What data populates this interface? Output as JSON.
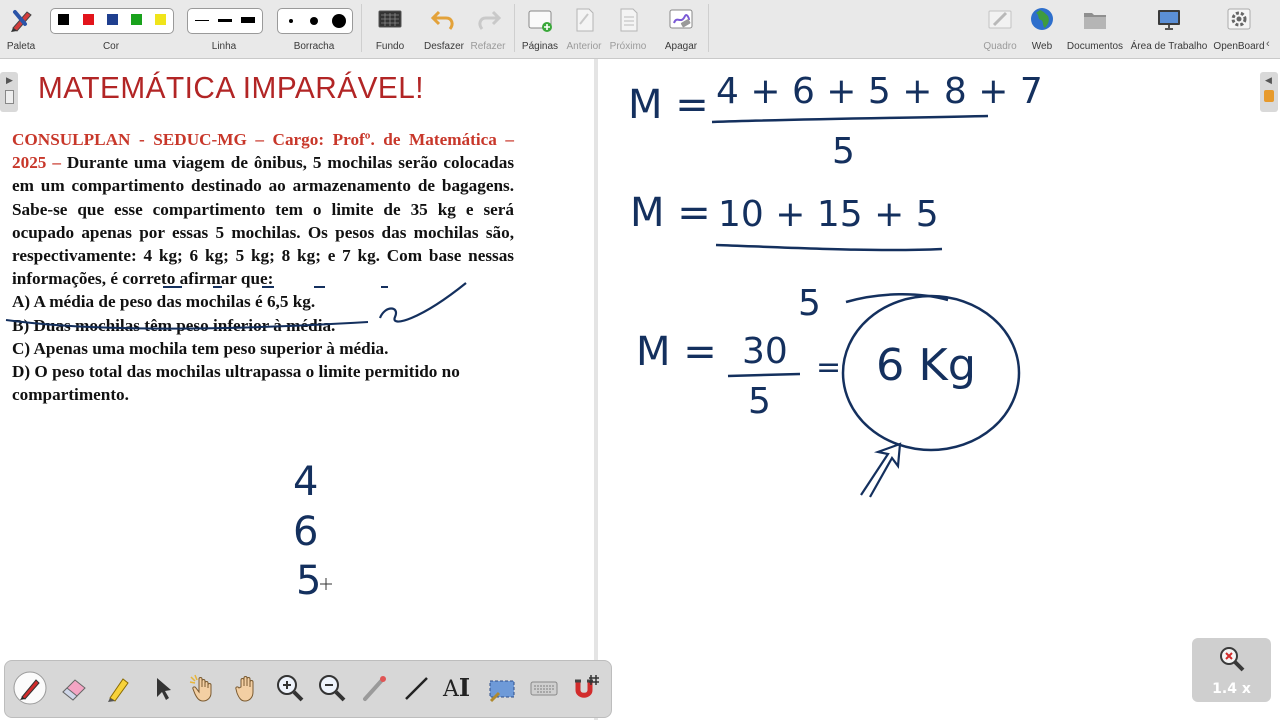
{
  "toolbar": {
    "palette_label": "Paleta",
    "color_label": "Cor",
    "line_label": "Linha",
    "eraser_label": "Borracha",
    "background_label": "Fundo",
    "undo_label": "Desfazer",
    "redo_label": "Refazer",
    "pages_label": "Páginas",
    "previous_label": "Anterior",
    "next_label": "Próximo",
    "erase_label": "Apagar",
    "board_label": "Quadro",
    "web_label": "Web",
    "documents_label": "Documentos",
    "desktop_label": "Área de Trabalho",
    "openboard_label": "OpenBoard",
    "colors": [
      "#000000",
      "#e2141b",
      "#1f3f8f",
      "#19a21c",
      "#f0e41a"
    ]
  },
  "page": {
    "title": "MATEMÁTICA IMPARÁVEL!",
    "question_source": "CONSULPLAN - SEDUC-MG – Cargo: Profº. de Matemática – 2025 –",
    "question_body": "Durante uma viagem de ônibus, 5 mochilas serão colocadas em um compartimento destinado ao armazenamento de bagagens. Sabe-se que esse compartimento tem o limite de 35 kg e será ocupado apenas por essas 5 mochilas. Os pesos das mochilas são, respectivamente: 4 kg; 6 kg; 5 kg; 8 kg; e 7 kg. Com base nessas informações, é correto afirmar que:",
    "options": [
      "A) A média de peso das mochilas é 6,5 kg.",
      "B) Duas mochilas têm peso inferior à média.",
      "C) Apenas uma mochila tem peso superior à média.",
      "D) O peso total das mochilas ultrapassa o limite permitido no compartimento."
    ]
  },
  "handwriting": {
    "left_numbers": [
      "4",
      "6",
      "5"
    ],
    "line1_label": "M =",
    "line1_numerator": "4 + 6 + 5 + 8 + 7",
    "line1_denominator": "5",
    "line2_label": "M =",
    "line2_expression": "10 + 15 + 5",
    "stray_digit": "5",
    "line3_label": "M =",
    "line3_numerator": "30",
    "line3_denominator": "5",
    "line3_equals": "=",
    "result": "6 Kg"
  },
  "zoom": {
    "level": "1.4 x"
  }
}
